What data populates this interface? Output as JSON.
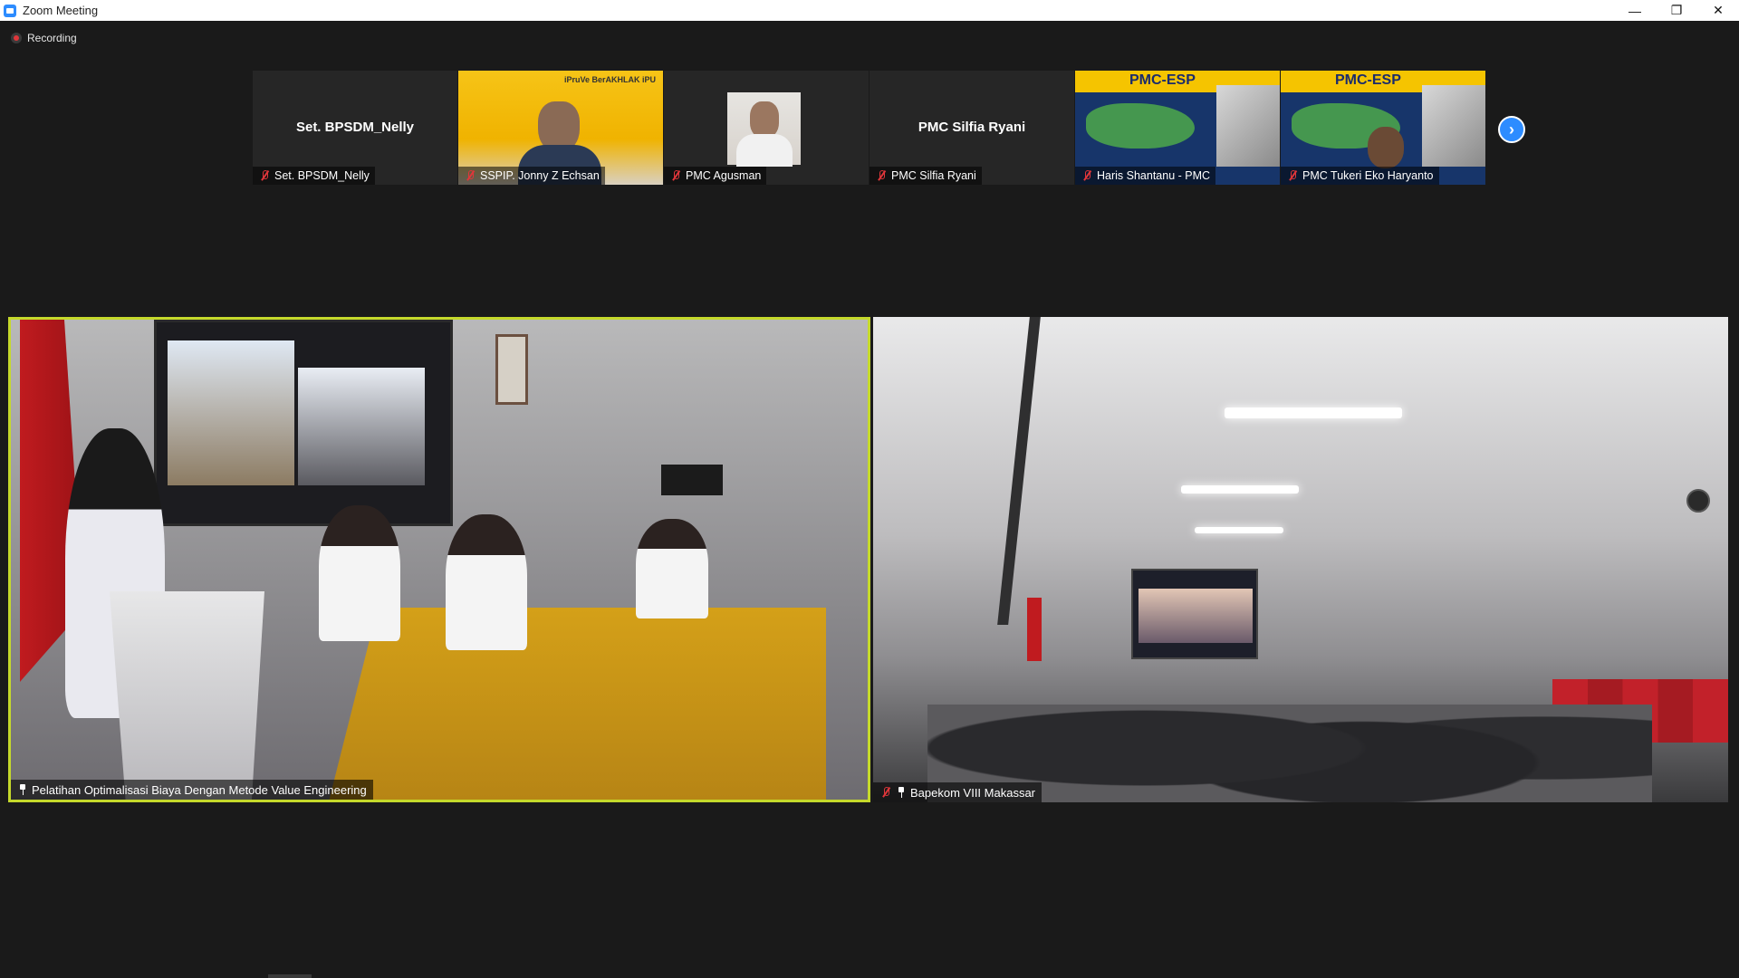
{
  "window": {
    "title": "Zoom Meeting",
    "minimize": "—",
    "restore": "❐",
    "close": "✕"
  },
  "recording": {
    "label": "Recording"
  },
  "gallery": [
    {
      "name": "Set. BPSDM_Nelly",
      "center_name": "Set. BPSDM_Nelly",
      "video": false,
      "muted": true
    },
    {
      "name": "SSPIP. Jonny Z Echsan",
      "video": true,
      "muted": true,
      "brand": "iPruVe BerAKHLAK iPU"
    },
    {
      "name": "PMC Agusman",
      "video": false,
      "photo": true,
      "muted": true
    },
    {
      "name": "PMC Silfia Ryani",
      "center_name": "PMC Silfia Ryani",
      "video": false,
      "muted": true
    },
    {
      "name": "Haris Shantanu - PMC",
      "video": true,
      "muted": true,
      "banner": "PMC-ESP"
    },
    {
      "name": "PMC Tukeri Eko Haryanto",
      "video": true,
      "muted": true,
      "banner": "PMC-ESP"
    }
  ],
  "next_page_icon": "chevron-right-icon",
  "main": {
    "left": {
      "name": "Pelatihan Optimalisasi Biaya Dengan Metode Value Engineering",
      "pinned": true,
      "active_speaker": true
    },
    "right": {
      "name": "Bapekom VIII Makassar",
      "pinned": true,
      "muted": true
    }
  },
  "colors": {
    "active_speaker_border": "#c5d92b",
    "accent": "#2d8cff",
    "mute_red": "#e0363a",
    "background": "#1a1a1a"
  }
}
